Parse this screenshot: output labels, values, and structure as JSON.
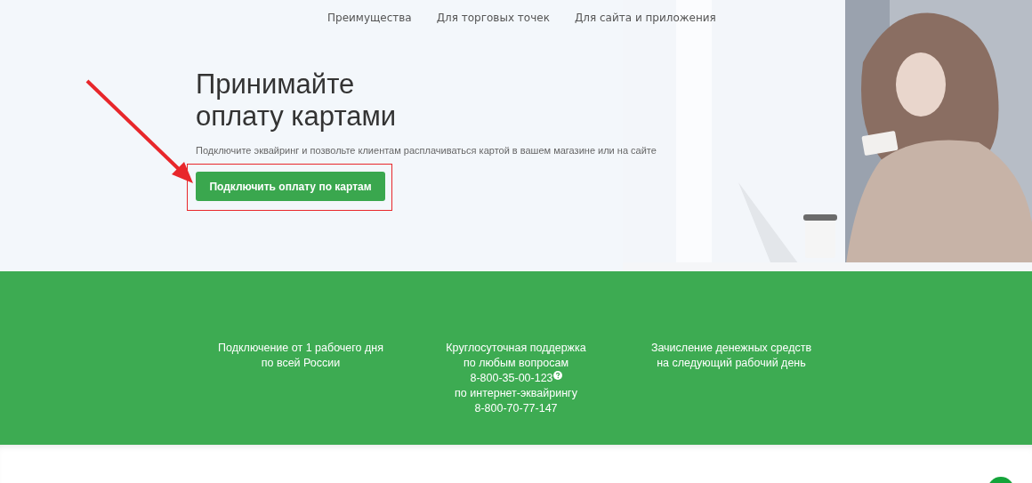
{
  "nav": [
    {
      "label": "Преимущества"
    },
    {
      "label": "Для торговых точек"
    },
    {
      "label": "Для сайта и приложения"
    }
  ],
  "hero": {
    "title_lines": [
      "Принимайте",
      "оплату картами"
    ],
    "subtitle": "Подключите эквайринг и позвольте клиентам расплачиваться картой в вашем магазине или на сайте",
    "button": "Подключить оплату по картам",
    "image": {
      "kind": "picture"
    }
  },
  "features": [
    {
      "lines": [
        {
          "kind": "text",
          "text": "Подключение от 1 рабочего дня"
        },
        {
          "kind": "text",
          "text": "по всей России"
        }
      ]
    },
    {
      "lines": [
        {
          "kind": "text",
          "text": "Круглосуточная поддержка"
        },
        {
          "kind": "text",
          "text": "по любым вопросам"
        },
        {
          "kind": "phone",
          "text": "8-800-35-00-123",
          "help": true
        },
        {
          "kind": "text",
          "text": "по интернет-эквайрингу"
        },
        {
          "kind": "phone",
          "text": "8-800-70-77-147",
          "help": false
        }
      ]
    },
    {
      "lines": [
        {
          "kind": "text",
          "text": "Зачисление денежных средств"
        },
        {
          "kind": "text",
          "text": "на следующий рабочий день"
        }
      ]
    }
  ]
}
